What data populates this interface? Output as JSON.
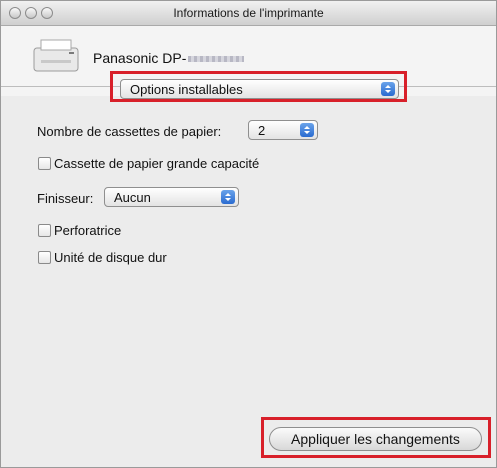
{
  "window": {
    "title": "Informations de l'imprimante"
  },
  "printer": {
    "name": "Panasonic DP-"
  },
  "options_popup": {
    "value": "Options installables"
  },
  "paper_cassettes": {
    "label": "Nombre de cassettes de papier:",
    "value": "2"
  },
  "checkboxes": {
    "high_capacity": {
      "label": "Cassette de papier grande capacité",
      "checked": false
    },
    "perforator": {
      "label": "Perforatrice",
      "checked": false
    },
    "hard_disk": {
      "label": "Unité de disque dur",
      "checked": false
    }
  },
  "finisher": {
    "label": "Finisseur:",
    "value": "Aucun"
  },
  "apply_button": {
    "label": "Appliquer les changements"
  },
  "colors": {
    "highlight": "#d8202a",
    "popup_arrow": "#2a6bd0"
  }
}
